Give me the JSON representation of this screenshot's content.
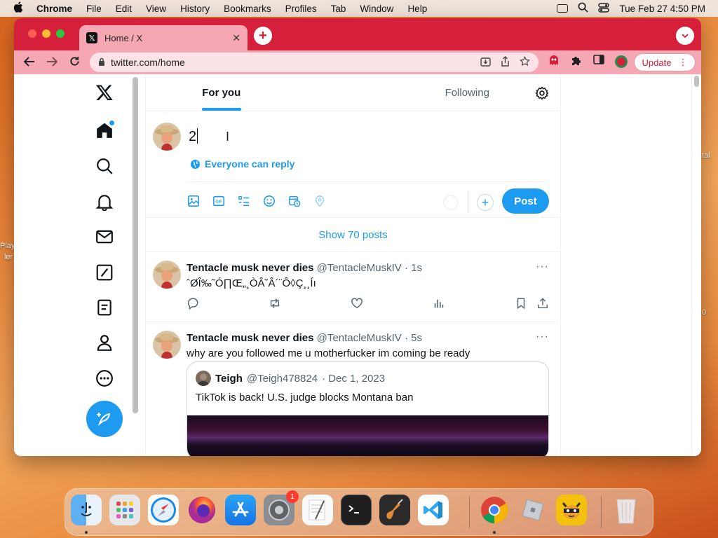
{
  "menubar": {
    "app": "Chrome",
    "items": [
      "File",
      "Edit",
      "View",
      "History",
      "Bookmarks",
      "Profiles",
      "Tab",
      "Window",
      "Help"
    ],
    "clock": "Tue Feb 27  4:50 PM"
  },
  "browser": {
    "tab_title": "Home / X",
    "url": "twitter.com/home",
    "update_label": "Update"
  },
  "feed": {
    "tabs": [
      "For you",
      "Following"
    ],
    "active_tab": "For you"
  },
  "composer": {
    "text": "2",
    "reply_setting": "Everyone can reply",
    "post_label": "Post",
    "tools": [
      "image-icon",
      "gif-icon",
      "poll-icon",
      "emoji-icon",
      "schedule-icon",
      "location-icon"
    ]
  },
  "show_posts": "Show 70 posts",
  "tweets": [
    {
      "name": "Tentacle musk never dies",
      "handle": "@TentacleMuskIV",
      "time": "· 1s",
      "text": "ˆØÎ‰˜Ó∏Œ„¸ÒÂ˘Â´¨Ô◊Ç¸¸Íı"
    },
    {
      "name": "Tentacle musk never dies",
      "handle": "@TentacleMuskIV",
      "time": "· 5s",
      "text": "why are you followed me u motherfucker im coming be ready",
      "quote": {
        "name": "Teigh",
        "handle": "@Teigh478824",
        "date": "· Dec 1, 2023",
        "text": "TikTok is back! U.S. judge blocks Montana ban"
      }
    }
  ],
  "desktop": {
    "left_label_1": "Play",
    "left_label_2": "ler",
    "right_label_1": "tal",
    "right_label_2": "0"
  },
  "dock": {
    "apps": [
      "Finder",
      "Launchpad",
      "Safari",
      "Firefox",
      "App Store",
      "System Settings",
      "TextEdit",
      "Terminal",
      "GarageBand",
      "Visual Studio Code",
      "Google Chrome",
      "Roblox",
      "Talking Tom",
      "Trash"
    ],
    "settings_badge": "1"
  },
  "colors": {
    "accent": "#1d9bf0",
    "tabbar": "#d61f3b",
    "toolbar": "#f5a8b3"
  }
}
